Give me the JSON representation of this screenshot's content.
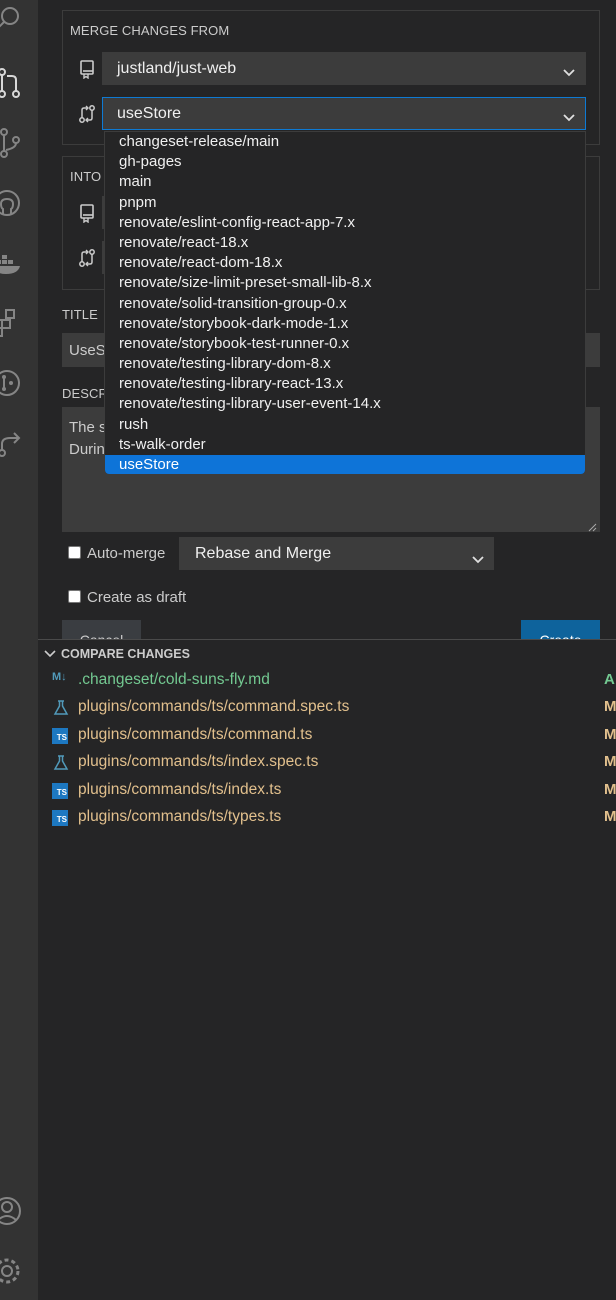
{
  "merge_from": {
    "label": "MERGE CHANGES FROM",
    "repo": "justland/just-web",
    "branch": "useStore"
  },
  "into": {
    "label_partial": "INTO"
  },
  "branch_options": [
    "changeset-release/main",
    "gh-pages",
    "main",
    "pnpm",
    "renovate/eslint-config-react-app-7.x",
    "renovate/react-18.x",
    "renovate/react-dom-18.x",
    "renovate/size-limit-preset-small-lib-8.x",
    "renovate/solid-transition-group-0.x",
    "renovate/storybook-dark-mode-1.x",
    "renovate/storybook-test-runner-0.x",
    "renovate/testing-library-dom-8.x",
    "renovate/testing-library-react-13.x",
    "renovate/testing-library-user-event-14.x",
    "rush",
    "ts-walk-order",
    "useStore"
  ],
  "selected_option": "useStore",
  "title": {
    "label": "TITLE",
    "value_partial": "UseS"
  },
  "description": {
    "label_partial": "DESCR",
    "line1_partial": "The s",
    "line2_partial": "Durin"
  },
  "auto_merge": {
    "label": "Auto-merge",
    "method": "Rebase and Merge"
  },
  "draft": {
    "label": "Create as draft"
  },
  "buttons": {
    "cancel": "Cancel",
    "create": "Create"
  },
  "compare": {
    "header": "COMPARE CHANGES",
    "files": [
      {
        "name": ".changeset/cold-suns-fly.md",
        "status": "A",
        "icon": "markdown-icon"
      },
      {
        "name": "plugins/commands/ts/command.spec.ts",
        "status": "M",
        "icon": "test-flask-icon"
      },
      {
        "name": "plugins/commands/ts/command.ts",
        "status": "M",
        "icon": "typescript-icon"
      },
      {
        "name": "plugins/commands/ts/index.spec.ts",
        "status": "M",
        "icon": "test-flask-icon"
      },
      {
        "name": "plugins/commands/ts/index.ts",
        "status": "M",
        "icon": "typescript-icon"
      },
      {
        "name": "plugins/commands/ts/types.ts",
        "status": "M",
        "icon": "typescript-icon"
      }
    ]
  },
  "icons": {
    "markdown_badge": "M↓",
    "ts_badge": "TS"
  }
}
